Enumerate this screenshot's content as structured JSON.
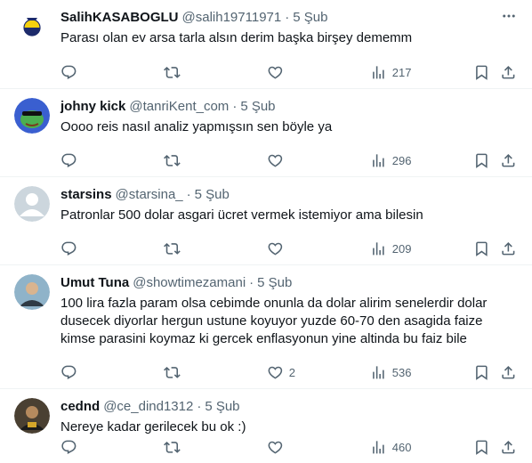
{
  "tweets": [
    {
      "name": "SalihKASABOGLU",
      "handle": "@salih19711971",
      "dot": "·",
      "time": "5 Şub",
      "text": [
        "Parası olan ev arsa tarla alsın derim başka birşey dememm"
      ],
      "replies": "",
      "retweets": "",
      "likes": "",
      "views": "217",
      "avatar": "team-logo"
    },
    {
      "name": "johny kick",
      "handle": "@tanriKent_com",
      "dot": "·",
      "time": "5 Şub",
      "text": [
        "Oooo reis nasıl analiz yapmışsın sen böyle ya"
      ],
      "replies": "",
      "retweets": "",
      "likes": "",
      "views": "296",
      "avatar": "frog"
    },
    {
      "name": "starsins",
      "handle": "@starsina_",
      "dot": "·",
      "time": "5 Şub",
      "text": [
        "Patronlar 500 dolar asgari ücret vermek istemiyor ama bilesin"
      ],
      "replies": "",
      "retweets": "",
      "likes": "",
      "views": "209",
      "avatar": "default"
    },
    {
      "name": "Umut Tuna",
      "handle": "@showtimezamani",
      "dot": "·",
      "time": "5 Şub",
      "text": [
        "100 lira fazla param olsa cebimde onunla da dolar alirim senelerdir dolar",
        "dusecek diyorlar hergun ustune koyuyor yuzde 60-70 den asagida faize",
        "kimse parasini koymaz ki gercek enflasyonun yine altinda bu faiz bile"
      ],
      "replies": "",
      "retweets": "",
      "likes": "2",
      "views": "536",
      "avatar": "photo"
    },
    {
      "name": "cednd",
      "handle": "@ce_dind1312",
      "dot": "·",
      "time": "5 Şub",
      "text": [
        "Nereye kadar gerilecek bu ok :)"
      ],
      "replies": "",
      "retweets": "",
      "likes": "",
      "views": "460",
      "avatar": "photo-dark"
    }
  ],
  "icons": {
    "more": "more-icon",
    "reply": "reply-icon",
    "retweet": "retweet-icon",
    "like": "like-icon",
    "views": "views-icon",
    "bookmark": "bookmark-icon",
    "share": "share-icon"
  },
  "colors": {
    "text": "#0f1419",
    "secondary": "#536471",
    "border": "#eff3f4"
  }
}
